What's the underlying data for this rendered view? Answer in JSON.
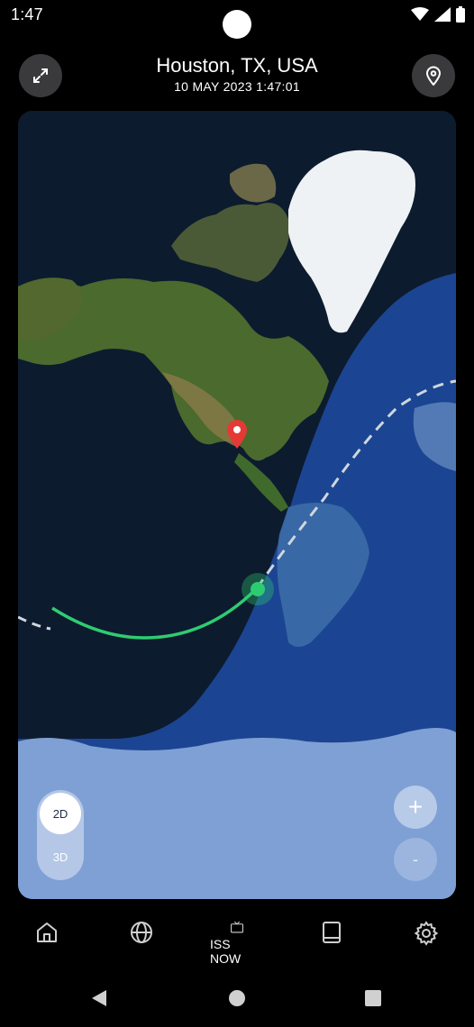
{
  "status": {
    "time": "1:47"
  },
  "header": {
    "location": "Houston, TX, USA",
    "datetime": "10 MAY 2023 1:47:01",
    "expand_icon": "expand-icon",
    "location_icon": "map-pin-icon"
  },
  "map": {
    "view_modes": [
      "2D",
      "3D"
    ],
    "selected_mode": "2D",
    "zoom_in_label": "+",
    "zoom_out_label": "-",
    "colors": {
      "orbit_path": "#2ecc71",
      "future_path": "#cfd6de",
      "marker": "#e53935",
      "daylight": "#1e4fa8"
    }
  },
  "nav": {
    "items": [
      {
        "icon": "home-icon",
        "label": ""
      },
      {
        "icon": "globe-icon",
        "label": ""
      },
      {
        "icon": "tv-icon",
        "label": "ISS NOW"
      },
      {
        "icon": "book-icon",
        "label": ""
      },
      {
        "icon": "gear-icon",
        "label": ""
      }
    ]
  }
}
